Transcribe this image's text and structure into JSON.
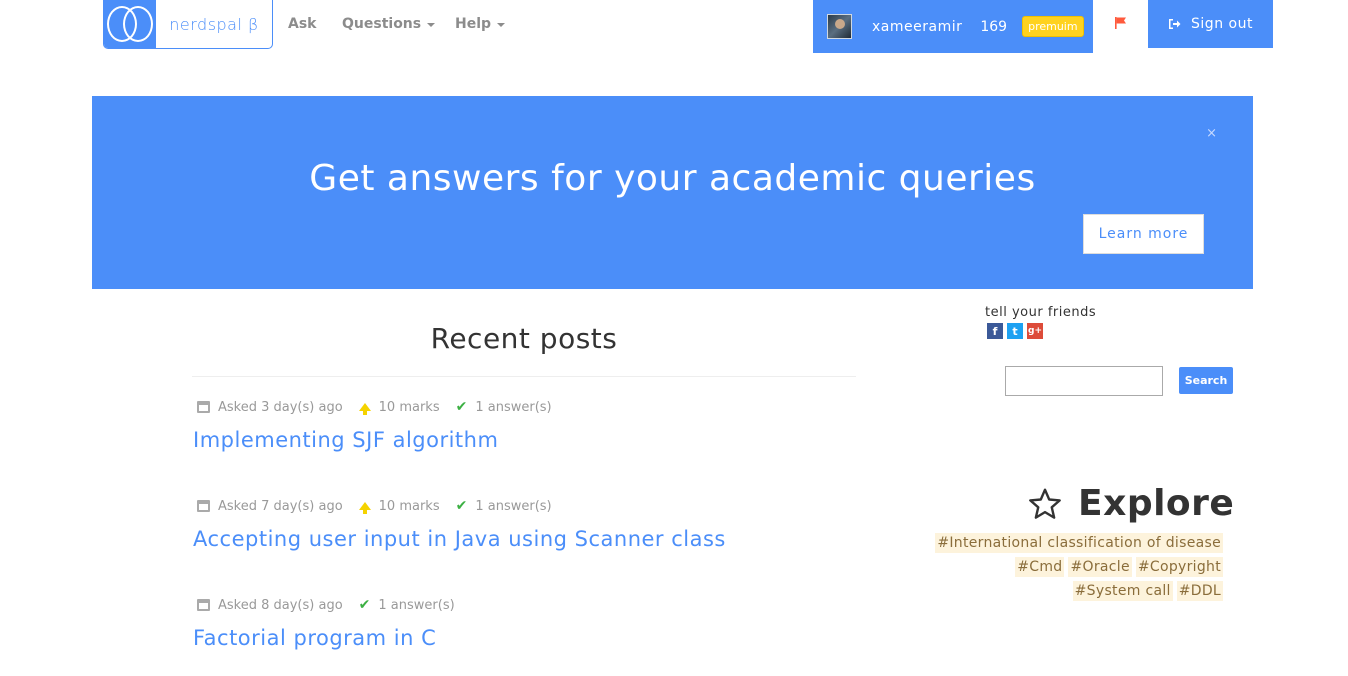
{
  "nav": {
    "brand": "nerdspal β",
    "links": [
      "Ask",
      "Questions",
      "Help"
    ],
    "username": "xameeramir",
    "points": "169",
    "badge": "premuim",
    "signout": "Sign out"
  },
  "hero": {
    "title": "Get answers for your academic queries",
    "close": "×",
    "cta": "Learn more"
  },
  "recent": {
    "heading": "Recent posts",
    "posts": [
      {
        "asked": "Asked 3 day(s) ago",
        "marks": "10 marks",
        "answers": "1 answer(s)",
        "title": "Implementing SJF algorithm"
      },
      {
        "asked": "Asked 7 day(s) ago",
        "marks": "10 marks",
        "answers": "1 answer(s)",
        "title": "Accepting user input in Java using Scanner class"
      },
      {
        "asked": "Asked 8 day(s) ago",
        "answers": "1 answer(s)",
        "title": "Factorial program in C"
      }
    ]
  },
  "sidebar": {
    "tell": "tell your friends",
    "search_button": "Search",
    "search_value": "",
    "explore": "Explore",
    "tags": [
      [
        "#International classification of disease"
      ],
      [
        "#Cmd",
        "#Oracle",
        "#Copyright"
      ],
      [
        "#System call",
        "#DDL"
      ]
    ]
  },
  "colors": {
    "brand": "#4b8ef9",
    "badge": "#ffd21f",
    "flag": "#ff5a3c",
    "tag_bg": "#fdf3dc"
  }
}
